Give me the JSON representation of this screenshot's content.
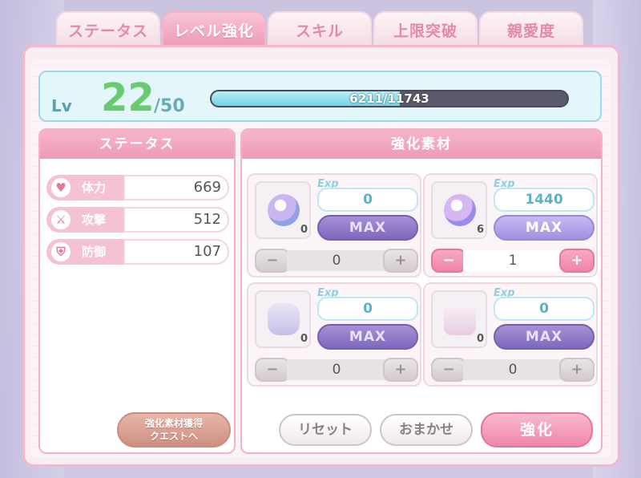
{
  "tabs": [
    "ステータス",
    "レベル強化",
    "スキル",
    "上限突破",
    "親愛度"
  ],
  "active_tab": "レベル強化",
  "level": {
    "label": "Lv",
    "current": "22",
    "max": "/50",
    "exp_text": "6211/11743",
    "exp_fraction": 0.529
  },
  "status": {
    "header": "ステータス",
    "stats": [
      {
        "icon": "heart-icon",
        "label": "体力",
        "value": "669"
      },
      {
        "icon": "sword-icon",
        "label": "攻撃",
        "value": "512"
      },
      {
        "icon": "shield-icon",
        "label": "防御",
        "value": "107"
      }
    ],
    "quest_button": "強化素材獲得\nクエストへ"
  },
  "materials": {
    "header": "強化素材",
    "exp_tag": "Exp",
    "max_label": "MAX",
    "items": [
      {
        "icon": "small-gem-icon",
        "count": "0",
        "exp": "0",
        "selected": "0"
      },
      {
        "icon": "twin-gem-icon",
        "count": "6",
        "exp": "1440",
        "selected": "1"
      },
      {
        "icon": "jar-icon",
        "count": "0",
        "exp": "0",
        "selected": "0"
      },
      {
        "icon": "teacup-icon",
        "count": "0",
        "exp": "0",
        "selected": "0"
      }
    ]
  },
  "actions": {
    "reset": "リセット",
    "auto": "おまかせ",
    "strengthen": "強化"
  },
  "stepper": {
    "minus": "−",
    "plus": "+"
  }
}
